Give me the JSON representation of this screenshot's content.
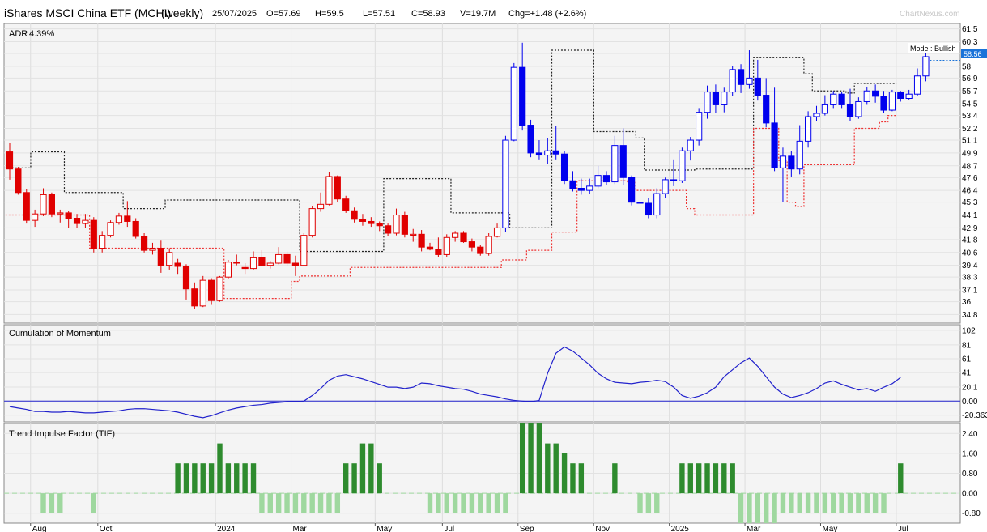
{
  "header": {
    "symbol": "iShares MSCI China ETF (MCHI)",
    "interval": "(weekly)",
    "date": "25/07/2025",
    "open": "O=57.69",
    "high": "H=59.5",
    "low": "L=57.51",
    "close": "C=58.93",
    "volume": "V=19.7M",
    "change": "Chg=+1.48 (+2.6%)",
    "brand": "ChartNexus.com"
  },
  "price_panel": {
    "adr_label": "ADR",
    "adr_value": "4.39%",
    "mode_label": "Mode : Bullish",
    "last_price": "58.56",
    "ticks": [
      "61.5",
      "60.3",
      "59.2",
      "58",
      "56.9",
      "55.7",
      "54.5",
      "53.4",
      "52.2",
      "51.1",
      "49.9",
      "48.7",
      "47.6",
      "46.4",
      "45.3",
      "44.1",
      "42.9",
      "41.8",
      "40.6",
      "39.4",
      "38.3",
      "37.1",
      "36",
      "34.8"
    ]
  },
  "momentum_panel": {
    "title": "Cumulation of Momentum",
    "ticks": [
      "102",
      "81",
      "61",
      "41",
      "20.1",
      "0.00",
      "-20.363"
    ]
  },
  "tif_panel": {
    "title": "Trend Impulse Factor (TIF)",
    "ticks": [
      "2.40",
      "1.60",
      "0.80",
      "0.00",
      "-0.80"
    ]
  },
  "x_axis": {
    "labels": [
      "Aug",
      "Oct",
      "2024",
      "Mar",
      "May",
      "Jul",
      "Sep",
      "Nov",
      "2025",
      "Mar",
      "May",
      "Jul"
    ]
  },
  "colors": {
    "up": "#0000ee",
    "down": "#e00000",
    "stop_upper": "#222222",
    "stop_lower": "#ee3333",
    "momentum": "#2222cc",
    "tif_pos": "#2e8b2e",
    "tif_neg": "#9fd89f",
    "last_price_bg": "#1a73d9"
  },
  "chart_data": [
    {
      "type": "candlestick",
      "title": "iShares MSCI China ETF (MCHI) (weekly)",
      "ylim": [
        34.0,
        62.0
      ],
      "x_start": "2023-07",
      "x_end": "2025-07-25",
      "candles": [
        [
          50,
          50.8,
          47.4,
          48.4
        ],
        [
          48.4,
          48.6,
          46,
          46.2
        ],
        [
          46.2,
          46.5,
          43.3,
          43.6
        ],
        [
          43.6,
          44.6,
          43,
          44.2
        ],
        [
          44.2,
          46.6,
          44,
          46
        ],
        [
          46,
          46.2,
          43.9,
          44.2
        ],
        [
          44.2,
          44.6,
          43.4,
          44.3
        ],
        [
          44.3,
          44.5,
          42.9,
          43.8
        ],
        [
          43.8,
          44.2,
          42.9,
          43.3
        ],
        [
          43.3,
          44.2,
          42.9,
          43.6
        ],
        [
          43.6,
          43.9,
          40.6,
          41
        ],
        [
          41,
          42.6,
          40.6,
          42.2
        ],
        [
          42.2,
          43.6,
          42,
          43.4
        ],
        [
          43.4,
          44.3,
          43.2,
          44
        ],
        [
          44,
          45.4,
          43,
          43.5
        ],
        [
          43.5,
          43.8,
          41.9,
          42.1
        ],
        [
          42.1,
          42.4,
          40.6,
          40.8
        ],
        [
          40.8,
          41.5,
          40.4,
          41
        ],
        [
          41,
          41.7,
          38.7,
          39.4
        ],
        [
          39.4,
          41,
          39,
          40.6
        ],
        [
          39.6,
          40,
          38.6,
          39.3
        ],
        [
          39.3,
          39.5,
          36.2,
          37.2
        ],
        [
          37.2,
          37.8,
          35.3,
          35.6
        ],
        [
          35.6,
          38.4,
          35.5,
          38
        ],
        [
          38,
          38.2,
          35.7,
          36.1
        ],
        [
          36.1,
          38.4,
          36,
          38.3
        ],
        [
          38.3,
          39.9,
          38.1,
          39.7
        ],
        [
          39.7,
          40.4,
          39.4,
          39.6
        ],
        [
          39.2,
          39.6,
          38.6,
          39.1
        ],
        [
          39.1,
          40.7,
          39,
          40.1
        ],
        [
          40.1,
          40.8,
          39.3,
          39.4
        ],
        [
          39.4,
          39.8,
          39.1,
          39.6
        ],
        [
          39.6,
          41.1,
          39.5,
          40.4
        ],
        [
          40.4,
          40.7,
          39.3,
          39.6
        ],
        [
          39.6,
          40.3,
          38.4,
          39.4
        ],
        [
          39.4,
          42.4,
          39.3,
          42.2
        ],
        [
          42.2,
          44.9,
          42,
          44.7
        ],
        [
          44.7,
          46.2,
          44.4,
          45.1
        ],
        [
          45.1,
          48.1,
          45,
          47.7
        ],
        [
          47.7,
          47.8,
          45.3,
          45.6
        ],
        [
          45.6,
          45.9,
          44.3,
          44.5
        ],
        [
          44.5,
          44.8,
          43.4,
          43.7
        ],
        [
          43.7,
          44.2,
          43.1,
          43.5
        ],
        [
          43.5,
          43.9,
          43,
          43.3
        ],
        [
          43.3,
          43.5,
          42.6,
          43.1
        ],
        [
          43.1,
          43.3,
          42.1,
          42.4
        ],
        [
          42.4,
          44.7,
          42.2,
          44.1
        ],
        [
          44.1,
          44.4,
          42,
          42.3
        ],
        [
          42.3,
          42.8,
          41.6,
          42.3
        ],
        [
          42.3,
          42.7,
          40.7,
          41.1
        ],
        [
          41.1,
          41.5,
          40.8,
          40.9
        ],
        [
          40.9,
          42,
          40.2,
          40.4
        ],
        [
          40.4,
          42.3,
          40.2,
          42
        ],
        [
          42,
          42.6,
          41.6,
          42.4
        ],
        [
          42.4,
          42.6,
          41.5,
          41.6
        ],
        [
          41.6,
          41.9,
          40.7,
          41.1
        ],
        [
          41.1,
          41.3,
          40.3,
          40.5
        ],
        [
          40.5,
          42.4,
          40.3,
          42.1
        ],
        [
          42.1,
          43.3,
          42,
          42.9
        ],
        [
          42.9,
          51.5,
          42.5,
          51.1
        ],
        [
          51.1,
          58.3,
          51,
          57.9
        ],
        [
          57.9,
          60.2,
          52,
          52.5
        ],
        [
          52.5,
          53,
          49.5,
          49.9
        ],
        [
          49.9,
          51.1,
          49.3,
          49.7
        ],
        [
          49.7,
          51.3,
          48.9,
          50.1
        ],
        [
          50.1,
          52.4,
          49.3,
          49.8
        ],
        [
          49.8,
          50.1,
          47,
          47.3
        ],
        [
          47.3,
          48.2,
          46.3,
          46.6
        ],
        [
          46.6,
          47.5,
          46,
          46.4
        ],
        [
          46.4,
          47.5,
          46.1,
          46.8
        ],
        [
          46.8,
          48.7,
          46.6,
          47.8
        ],
        [
          47.8,
          48.2,
          46.9,
          47.2
        ],
        [
          47.2,
          51.5,
          47,
          50.6
        ],
        [
          50.6,
          52.2,
          46.9,
          47.6
        ],
        [
          47.6,
          47.8,
          45,
          45.3
        ],
        [
          45.3,
          46.1,
          45,
          45.2
        ],
        [
          45.2,
          45.7,
          43.8,
          44.1
        ],
        [
          44.1,
          46.6,
          43.8,
          46.1
        ],
        [
          46.1,
          47.6,
          45.7,
          47.4
        ],
        [
          47.4,
          49.3,
          46.8,
          47.3
        ],
        [
          47.3,
          50.4,
          47.1,
          50.1
        ],
        [
          50.1,
          51.4,
          49.2,
          51.1
        ],
        [
          51.1,
          54.1,
          50.6,
          53.7
        ],
        [
          53.7,
          56.2,
          53.1,
          55.6
        ],
        [
          55.6,
          56.3,
          53.6,
          54.4
        ],
        [
          54.4,
          56,
          53.7,
          55.6
        ],
        [
          55.6,
          58,
          55.2,
          57.7
        ],
        [
          57.7,
          58.2,
          55.5,
          56.3
        ],
        [
          56.3,
          59.5,
          55.9,
          56.9
        ],
        [
          56.9,
          58.6,
          54.8,
          55.3
        ],
        [
          55.3,
          56.9,
          52.3,
          52.7
        ],
        [
          52.7,
          56,
          48.2,
          48.5
        ],
        [
          48.5,
          50.4,
          45.3,
          49.6
        ],
        [
          49.6,
          50.1,
          47.7,
          48.4
        ],
        [
          48.4,
          52.5,
          47.9,
          51
        ],
        [
          51,
          53.8,
          50.4,
          53.3
        ],
        [
          53.3,
          54.3,
          52.9,
          53.6
        ],
        [
          53.6,
          55.3,
          53.4,
          54.4
        ],
        [
          54.4,
          55.7,
          54.1,
          55.4
        ],
        [
          55.4,
          55.6,
          54.1,
          54.4
        ],
        [
          54.4,
          55.9,
          52.9,
          53.3
        ],
        [
          53.3,
          55.1,
          53.1,
          54.7
        ],
        [
          54.7,
          56.1,
          54.4,
          55.7
        ],
        [
          55.7,
          56.3,
          54.6,
          55.2
        ],
        [
          55.2,
          55.7,
          53.6,
          53.9
        ],
        [
          53.9,
          55.8,
          53.8,
          55.6
        ],
        [
          55.6,
          55.7,
          54.7,
          55
        ],
        [
          55,
          55.8,
          54.9,
          55.4
        ],
        [
          55.4,
          57.8,
          55.2,
          57.1
        ],
        [
          57.1,
          59.5,
          56.6,
          58.9
        ]
      ],
      "stop_upper": [
        [
          0,
          48.5
        ],
        [
          2,
          48.5
        ],
        [
          3,
          50
        ],
        [
          6,
          50
        ],
        [
          7,
          46.2
        ],
        [
          13,
          46.2
        ],
        [
          14,
          44.7
        ],
        [
          18,
          44.7
        ],
        [
          19,
          45.5
        ],
        [
          34,
          45.5
        ],
        [
          35,
          40.7
        ],
        [
          44,
          40.7
        ],
        [
          45,
          47.5
        ],
        [
          52,
          47.5
        ],
        [
          53,
          44.3
        ],
        [
          59,
          44.3
        ],
        [
          60,
          42.9
        ],
        [
          64,
          42.9
        ],
        [
          65,
          59.5
        ],
        [
          69,
          59.5
        ],
        [
          70,
          51.9
        ],
        [
          74,
          51.9
        ],
        [
          75,
          51.3
        ],
        [
          76,
          48.3
        ],
        [
          81,
          48.3
        ],
        [
          82,
          48.4
        ],
        [
          88,
          48.4
        ],
        [
          89,
          58.8
        ],
        [
          94,
          58.8
        ],
        [
          95,
          57.3
        ],
        [
          96,
          55.7
        ],
        [
          99,
          55.7
        ],
        [
          100,
          55.5
        ],
        [
          101,
          56.4
        ],
        [
          105,
          56.4
        ]
      ],
      "stop_lower": [
        [
          0,
          44.1
        ],
        [
          9,
          44.1
        ],
        [
          10,
          41
        ],
        [
          17,
          41
        ],
        [
          18,
          41
        ],
        [
          25,
          41
        ],
        [
          26,
          36.3
        ],
        [
          33,
          36.3
        ],
        [
          34,
          37.9
        ],
        [
          35,
          38.4
        ],
        [
          40,
          38.4
        ],
        [
          41,
          39.2
        ],
        [
          58,
          39.2
        ],
        [
          59,
          39.9
        ],
        [
          61,
          39.9
        ],
        [
          62,
          40.8
        ],
        [
          64,
          40.8
        ],
        [
          65,
          42.5
        ],
        [
          67,
          42.5
        ],
        [
          68,
          47.3
        ],
        [
          73,
          47.3
        ],
        [
          74,
          47.2
        ],
        [
          75,
          46.4
        ],
        [
          80,
          46.4
        ],
        [
          81,
          44.7
        ],
        [
          82,
          44.1
        ],
        [
          88,
          44.1
        ],
        [
          89,
          52.2
        ],
        [
          91,
          52.2
        ],
        [
          92,
          49.2
        ],
        [
          93,
          45.3
        ],
        [
          94,
          44.9
        ],
        [
          95,
          48.8
        ],
        [
          100,
          48.8
        ],
        [
          101,
          52.2
        ],
        [
          104,
          52.8
        ],
        [
          105,
          53.4
        ]
      ]
    },
    {
      "type": "line",
      "title": "Cumulation of Momentum",
      "ylim": [
        -30,
        110
      ],
      "values": [
        -8,
        -10,
        -12,
        -15,
        -15,
        -16,
        -16,
        -15,
        -16,
        -17,
        -17,
        -16,
        -15,
        -14,
        -12,
        -11,
        -11,
        -12,
        -13,
        -14,
        -16,
        -19,
        -22,
        -24,
        -21,
        -17,
        -13,
        -10,
        -8,
        -6,
        -5,
        -3,
        -2,
        -1,
        -1,
        0,
        8,
        18,
        30,
        36,
        38,
        35,
        32,
        28,
        24,
        20,
        20,
        18,
        20,
        26,
        25,
        22,
        20,
        18,
        17,
        14,
        10,
        8,
        6,
        3,
        1,
        0,
        -1,
        1,
        40,
        69,
        78,
        72,
        62,
        52,
        40,
        32,
        27,
        26,
        25,
        27,
        28,
        30,
        28,
        20,
        8,
        4,
        7,
        12,
        20,
        35,
        45,
        55,
        62,
        50,
        35,
        20,
        10,
        5,
        8,
        12,
        18,
        26,
        29,
        24,
        20,
        16,
        18,
        14,
        20,
        25,
        34
      ]
    },
    {
      "type": "bar",
      "title": "Trend Impulse Factor (TIF)",
      "ylim": [
        -1.2,
        2.8
      ],
      "values": [
        0,
        0,
        0,
        0,
        -0.8,
        -0.8,
        -0.8,
        0,
        0,
        0,
        -0.8,
        0,
        0,
        0,
        0,
        0,
        0,
        0,
        0,
        0,
        1.2,
        1.2,
        1.2,
        1.2,
        1.2,
        2.0,
        1.2,
        1.2,
        1.2,
        1.2,
        -0.8,
        -0.8,
        -0.8,
        -0.8,
        -0.8,
        -0.8,
        -0.8,
        -0.8,
        -0.8,
        -0.8,
        1.2,
        1.2,
        2.0,
        2.0,
        1.2,
        0,
        0,
        0,
        0,
        0,
        -0.8,
        -0.8,
        -0.8,
        -0.8,
        -0.8,
        -0.8,
        -0.8,
        -0.8,
        -0.8,
        -0.8,
        0,
        2.8,
        2.8,
        2.8,
        2.0,
        2.0,
        1.6,
        1.2,
        1.2,
        0,
        0,
        0,
        1.2,
        0,
        0,
        -0.8,
        -0.8,
        -0.8,
        0,
        0,
        1.2,
        1.2,
        1.2,
        1.2,
        1.2,
        1.2,
        1.2,
        -1.2,
        -1.2,
        -1.2,
        -1.2,
        -1.2,
        -0.8,
        -0.8,
        -0.8,
        -0.8,
        -0.8,
        -0.8,
        -0.8,
        -0.8,
        -0.8,
        -0.8,
        -0.8,
        -0.8,
        -0.8,
        0,
        1.2
      ]
    }
  ]
}
